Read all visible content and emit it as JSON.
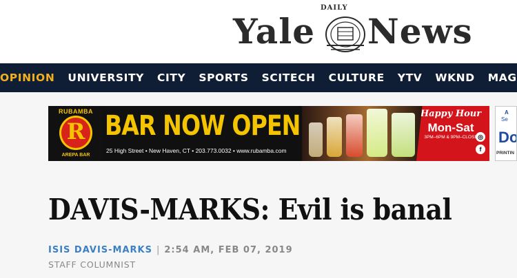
{
  "masthead": {
    "daily_label": "DAILY",
    "word_left": "Yale",
    "word_right": "News"
  },
  "nav": {
    "items": [
      {
        "label": "OPINION",
        "active": true
      },
      {
        "label": "UNIVERSITY"
      },
      {
        "label": "CITY"
      },
      {
        "label": "SPORTS"
      },
      {
        "label": "SCITECH"
      },
      {
        "label": "CULTURE"
      },
      {
        "label": "YTV"
      },
      {
        "label": "WKND"
      },
      {
        "label": "MAG"
      }
    ]
  },
  "ad_banner": {
    "brand_top": "RUBAMBA",
    "brand_letter": "R",
    "brand_bottom": "AREPA BAR",
    "headline": "BAR NOW OPEN",
    "address": "25 High Street • New Haven, CT • 203.773.0032 • www.rubamba.com",
    "happy_hour_title": "Happy Hour",
    "happy_hour_days": "Mon-Sat",
    "happy_hour_times": "3PM–6PM & 9PM–CLOSE",
    "social_1": "◎",
    "social_2": "f"
  },
  "ad_side": {
    "line1": "A",
    "line2": "Se",
    "logo": "Do",
    "line3": "PRINTIN"
  },
  "article": {
    "title": "DAVIS-MARKS: Evil is banal",
    "author": "ISIS DAVIS-MARKS",
    "separator": "|",
    "timestamp": "2:54 AM, FEB 07, 2019",
    "role": "STAFF COLUMNIST"
  },
  "colors": {
    "nav_bg": "#0f1e35",
    "nav_active": "#f2b01e",
    "author_link": "#3b7fc4",
    "ad_yellow": "#f5c400",
    "ad_red": "#d3141b"
  }
}
